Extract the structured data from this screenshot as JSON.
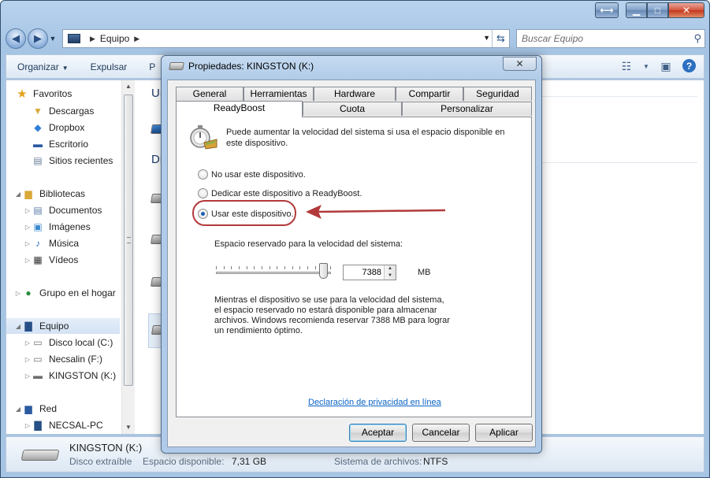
{
  "explorer": {
    "breadcrumb": "Equipo",
    "search_placeholder": "Buscar Equipo",
    "toolbar": {
      "organize": "Organizar",
      "eject": "Expulsar",
      "partial": "P"
    },
    "nav": {
      "favorites": "Favoritos",
      "downloads": "Descargas",
      "dropbox": "Dropbox",
      "desktop": "Escritorio",
      "recent": "Sitios recientes",
      "libraries": "Bibliotecas",
      "documents": "Documentos",
      "images": "Imágenes",
      "music": "Música",
      "videos": "Vídeos",
      "homegroup": "Grupo en el hogar",
      "computer": "Equipo",
      "disk_c": "Disco local (C:)",
      "disk_f": "Necsalin (F:)",
      "disk_k": "KINGSTON (K:)",
      "network": "Red",
      "pc": "NECSAL-PC"
    },
    "groups": {
      "first_partial": "Ur",
      "second_partial": "Di"
    },
    "details": {
      "name": "KINGSTON (K:)",
      "type": "Disco extraíble",
      "free_label": "Espacio disponible:",
      "free_value": "7,31 GB",
      "fs_label": "Sistema de archivos:",
      "fs_value": "NTFS"
    }
  },
  "dialog": {
    "title": "Propiedades: KINGSTON (K:)",
    "close": "✕",
    "tabs_row1": [
      "General",
      "Herramientas",
      "Hardware",
      "Compartir",
      "Seguridad"
    ],
    "tabs_row2": [
      "ReadyBoost",
      "Cuota",
      "Personalizar"
    ],
    "intro": "Puede aumentar la velocidad del sistema si usa el espacio disponible en este dispositivo.",
    "options": [
      "No usar este dispositivo.",
      "Dedicar este dispositivo a ReadyBoost.",
      "Usar este dispositivo."
    ],
    "selected_option": 2,
    "reserve_label": "Espacio reservado para la velocidad del sistema:",
    "reserve_value": "7388",
    "reserve_unit": "MB",
    "slider_level": 0.97,
    "note": "Mientras el dispositivo se use para la velocidad del sistema, el espacio reservado no estará disponible para almacenar archivos. Windows recomienda reservar 7388 MB para lograr un rendimiento óptimo.",
    "privacy_link": "Declaración de privacidad en línea",
    "buttons": {
      "ok": "Aceptar",
      "cancel": "Cancelar",
      "apply": "Aplicar"
    }
  },
  "colors": {
    "annotation": "#b33a3a",
    "link": "#0b63c5"
  }
}
